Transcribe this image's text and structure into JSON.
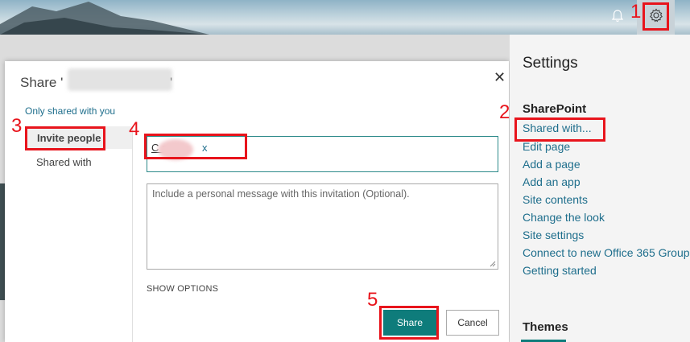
{
  "dialog": {
    "title": "Share '",
    "title_end": "'",
    "close_icon": "close-icon",
    "only_shared": "Only shared with you",
    "nav_invite": "Invite people",
    "nav_shared_with": "Shared with",
    "people_name": "C          ay",
    "people_remove": "x",
    "message_placeholder": "Include a personal message with this invitation (Optional).",
    "show_options": "SHOW OPTIONS",
    "share_label": "Share",
    "cancel_label": "Cancel"
  },
  "settings": {
    "title": "Settings",
    "section": "SharePoint",
    "links": [
      "Shared with...",
      "Edit page",
      "Add a page",
      "Add an app",
      "Site contents",
      "Change the look",
      "Site settings",
      "Connect to new Office 365 Group",
      "Getting started"
    ],
    "themes_heading": "Themes"
  },
  "annotations": [
    "1",
    "2",
    "3",
    "4",
    "5"
  ],
  "colors": {
    "accent": "#0e7c7b",
    "link": "#1e6e8c",
    "annotation": "#e8141c"
  }
}
